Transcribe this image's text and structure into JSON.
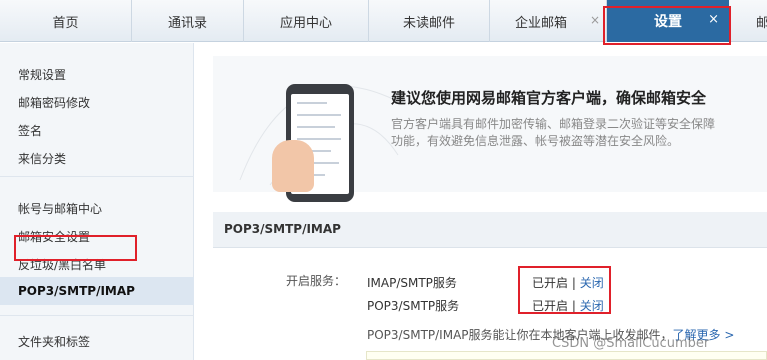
{
  "tabs": [
    {
      "label": "首页"
    },
    {
      "label": "通讯录"
    },
    {
      "label": "应用中心"
    },
    {
      "label": "未读邮件"
    },
    {
      "label": "企业邮箱"
    },
    {
      "label": "设置"
    },
    {
      "label": "邮"
    }
  ],
  "tab_close_glyph": "×",
  "sidebar": {
    "items": [
      {
        "label": "常规设置"
      },
      {
        "label": "邮箱密码修改"
      },
      {
        "label": "签名"
      },
      {
        "label": "来信分类"
      },
      {
        "label": "帐号与邮箱中心"
      },
      {
        "label": "邮箱安全设置"
      },
      {
        "label": "反垃圾/黑白名单"
      },
      {
        "label": "POP3/SMTP/IMAP"
      },
      {
        "label": "文件夹和标签"
      }
    ]
  },
  "banner": {
    "title": "建议您使用网易邮箱官方客户端，确保邮箱安全",
    "description": "官方客户端具有邮件加密传输、邮箱登录二次验证等安全保障功能，有效避免信息泄露、帐号被盗等潜在安全风险。"
  },
  "section": {
    "title": "POP3/SMTP/IMAP",
    "service_label": "开启服务：",
    "services": [
      {
        "name": "IMAP/SMTP服务",
        "status": "已开启",
        "separator": "|",
        "action": "关闭"
      },
      {
        "name": "POP3/SMTP服务",
        "status": "已开启",
        "separator": "|",
        "action": "关闭"
      }
    ],
    "description": "POP3/SMTP/IMAP服务能让你在本地客户端上收发邮件，",
    "learn_more": "了解更多 >"
  },
  "watermark": "CSDN @SmallCucumber",
  "colors": {
    "active_tab": "#2b6aa2",
    "highlight_border": "#e0202a",
    "link": "#2c68b0",
    "sidebar_bg": "#f3f6f9"
  }
}
